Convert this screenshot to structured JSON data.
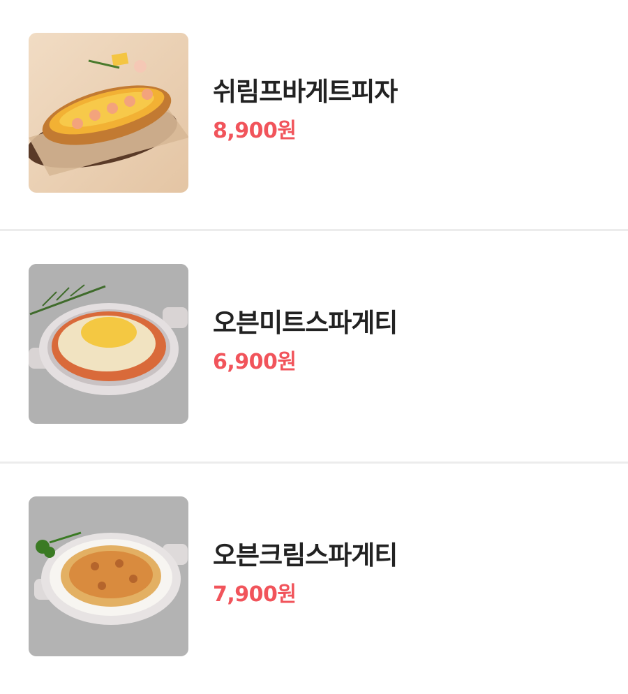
{
  "menu": {
    "items": [
      {
        "name": "쉬림프바게트피자",
        "price": "8,900원",
        "image_icon": "shrimp-baguette-pizza-photo"
      },
      {
        "name": "오븐미트스파게티",
        "price": "6,900원",
        "image_icon": "oven-meat-spaghetti-photo"
      },
      {
        "name": "오븐크림스파게티",
        "price": "7,900원",
        "image_icon": "oven-cream-spaghetti-photo"
      }
    ]
  },
  "colors": {
    "price": "#f1545b",
    "name": "#222222",
    "divider": "#ececec",
    "background": "#ffffff"
  }
}
